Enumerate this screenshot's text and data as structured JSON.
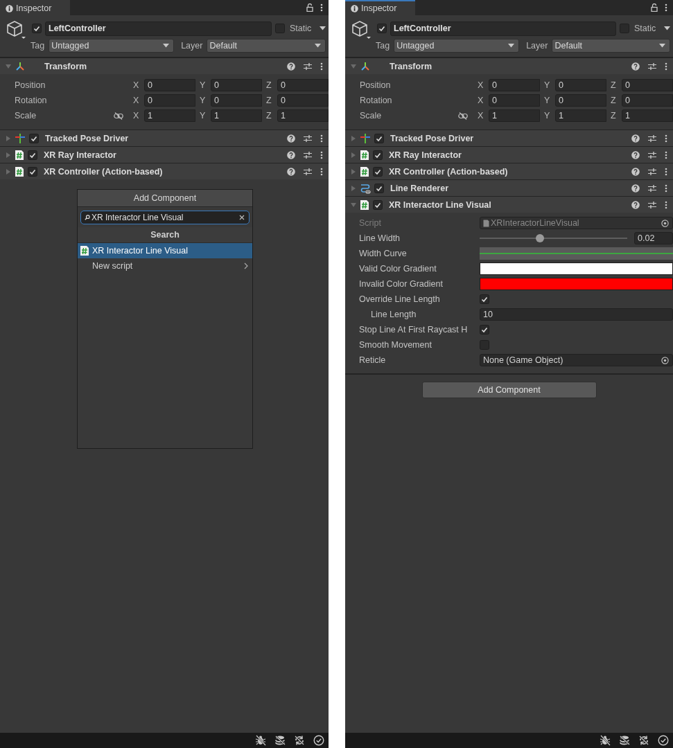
{
  "panels": [
    {
      "tab": {
        "label": "Inspector",
        "focused": false
      },
      "object": {
        "active": true,
        "name": "LeftController",
        "static_label": "Static",
        "static": false,
        "tag_label": "Tag",
        "tag": "Untagged",
        "layer_label": "Layer",
        "layer": "Default"
      },
      "components": [
        {
          "kind": "transform",
          "title": "Transform",
          "expanded": true,
          "rows": [
            {
              "label": "Position",
              "proportions_toggle": false,
              "axes": [
                {
                  "axis": "X",
                  "value": "0"
                },
                {
                  "axis": "Y",
                  "value": "0"
                },
                {
                  "axis": "Z",
                  "value": "0"
                }
              ]
            },
            {
              "label": "Rotation",
              "proportions_toggle": false,
              "axes": [
                {
                  "axis": "X",
                  "value": "0"
                },
                {
                  "axis": "Y",
                  "value": "0"
                },
                {
                  "axis": "Z",
                  "value": "0"
                }
              ]
            },
            {
              "label": "Scale",
              "proportions_toggle": true,
              "axes": [
                {
                  "axis": "X",
                  "value": "1"
                },
                {
                  "axis": "Y",
                  "value": "1"
                },
                {
                  "axis": "Z",
                  "value": "1"
                }
              ]
            }
          ]
        },
        {
          "kind": "pose",
          "title": "Tracked Pose Driver",
          "enabled": true,
          "expanded": false
        },
        {
          "kind": "script",
          "title": "XR Ray Interactor",
          "enabled": true,
          "expanded": false
        },
        {
          "kind": "script",
          "title": "XR Controller (Action-based)",
          "enabled": true,
          "expanded": false
        }
      ],
      "popup": {
        "title": "Add Component",
        "search": "XR Interactor Line Visual",
        "section": "Search",
        "items": [
          {
            "kind": "script",
            "label": "XR Interactor Line Visual",
            "selected": true
          },
          {
            "kind": "submenu",
            "label": "New script",
            "selected": false
          }
        ]
      }
    },
    {
      "tab": {
        "label": "Inspector",
        "focused": true
      },
      "object": {
        "active": true,
        "name": "LeftController",
        "static_label": "Static",
        "static": false,
        "tag_label": "Tag",
        "tag": "Untagged",
        "layer_label": "Layer",
        "layer": "Default"
      },
      "components": [
        {
          "kind": "transform",
          "title": "Transform",
          "expanded": true,
          "rows": [
            {
              "label": "Position",
              "proportions_toggle": false,
              "axes": [
                {
                  "axis": "X",
                  "value": "0"
                },
                {
                  "axis": "Y",
                  "value": "0"
                },
                {
                  "axis": "Z",
                  "value": "0"
                }
              ]
            },
            {
              "label": "Rotation",
              "proportions_toggle": false,
              "axes": [
                {
                  "axis": "X",
                  "value": "0"
                },
                {
                  "axis": "Y",
                  "value": "0"
                },
                {
                  "axis": "Z",
                  "value": "0"
                }
              ]
            },
            {
              "label": "Scale",
              "proportions_toggle": true,
              "axes": [
                {
                  "axis": "X",
                  "value": "1"
                },
                {
                  "axis": "Y",
                  "value": "1"
                },
                {
                  "axis": "Z",
                  "value": "1"
                }
              ]
            }
          ]
        },
        {
          "kind": "pose",
          "title": "Tracked Pose Driver",
          "enabled": true,
          "expanded": false
        },
        {
          "kind": "script",
          "title": "XR Ray Interactor",
          "enabled": true,
          "expanded": false
        },
        {
          "kind": "script",
          "title": "XR Controller (Action-based)",
          "enabled": true,
          "expanded": false
        },
        {
          "kind": "line",
          "title": "Line Renderer",
          "enabled": true,
          "expanded": false
        },
        {
          "kind": "script",
          "title": "XR Interactor Line Visual",
          "enabled": true,
          "expanded": true,
          "fields": [
            {
              "kind": "object",
              "label": "Script",
              "value": "XRInteractorLineVisual",
              "disabled": true
            },
            {
              "kind": "slider",
              "label": "Line Width",
              "level": 0.41,
              "value": "0.02"
            },
            {
              "kind": "curve",
              "label": "Width Curve"
            },
            {
              "kind": "color",
              "label": "Valid Color Gradient",
              "color": "#ffffff"
            },
            {
              "kind": "color",
              "label": "Invalid Color Gradient",
              "color": "#ff0000"
            },
            {
              "kind": "checkbox",
              "label": "Override Line Length",
              "checked": true,
              "children": [
                {
                  "kind": "number",
                  "label": "Line Length",
                  "value": "10"
                }
              ]
            },
            {
              "kind": "checkbox",
              "label": "Stop Line At First Raycast H",
              "checked": true
            },
            {
              "kind": "checkbox",
              "label": "Smooth Movement",
              "checked": false
            },
            {
              "kind": "object",
              "label": "Reticle",
              "value": "None (Game Object)",
              "disabled": false
            }
          ]
        }
      ],
      "add_button": {
        "label": "Add Component"
      }
    }
  ]
}
